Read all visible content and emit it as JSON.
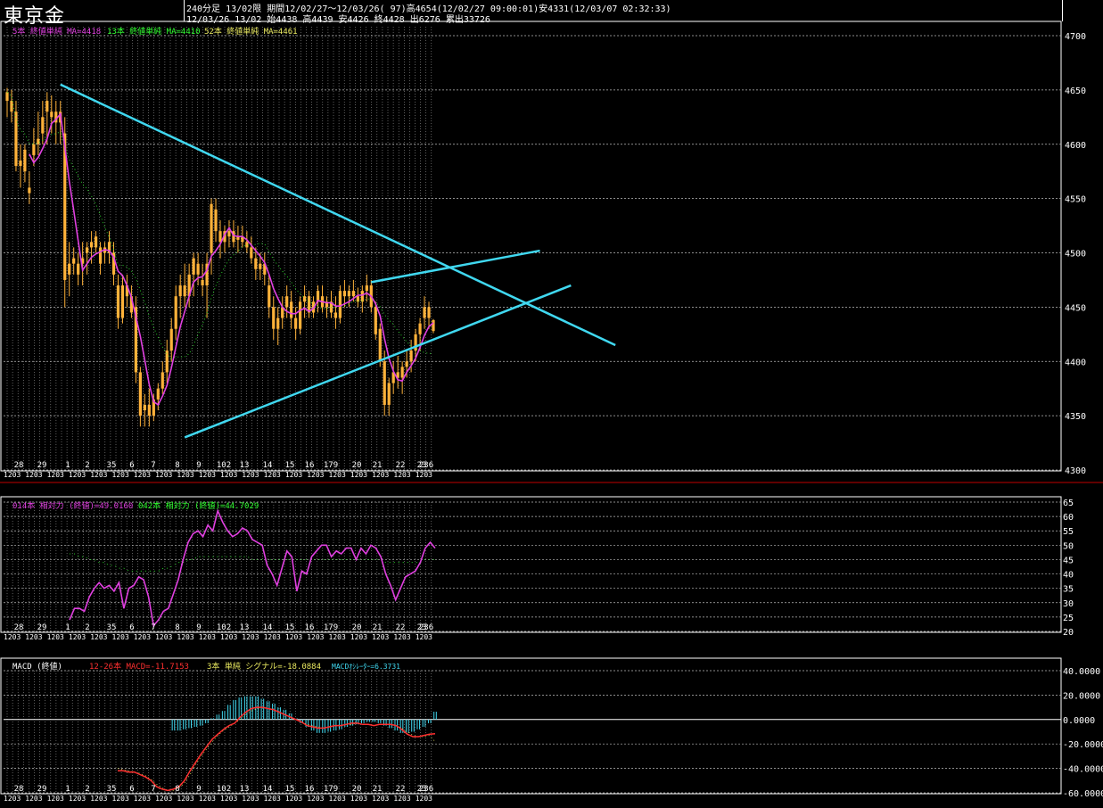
{
  "header": {
    "title": "東京金",
    "line1": "240分足 13/02限 期間12/02/27〜12/03/26( 97)高4654(12/02/27 09:00:01)安4331(12/03/07 02:32:33)",
    "line2": "12/03/26 13/02 始4438 高4439 安4426 終4428 出6276 累出33726"
  },
  "colors": {
    "up": "#ffb23a",
    "down": "#ffb23a",
    "ma5": "#e040e0",
    "ma13": "#30ff30",
    "ma52": "#e8e860",
    "trend": "#40d8f0",
    "grid": "#ffffff",
    "rsi14": "#e040e0",
    "rsi42": "#30ff30",
    "macd": "#ff3030",
    "signal": "#e8e860",
    "osc": "#40d8f0"
  },
  "x_labels": [
    "28",
    "29",
    "1",
    "2",
    "35",
    "6",
    "7",
    "8",
    "9",
    "102",
    "13",
    "14",
    "15",
    "16",
    "179",
    "20",
    "21",
    "22",
    "23",
    "236"
  ],
  "x_sub_label": "1203",
  "price_panel": {
    "legend_ma5": "5本 終値単純 MA=4418",
    "legend_ma13": "13本 終値単純 MA=4410",
    "legend_ma52": "52本 終値単純 MA=4461",
    "y_ticks": [
      "4700",
      "4650",
      "4600",
      "4550",
      "4500",
      "4450",
      "4400",
      "4350",
      "4300"
    ]
  },
  "rsi_panel": {
    "legend_rsi14": "014本 相対力 (終値)=49.0160",
    "legend_rsi42": "042本 相対力 (終値)=44.7029",
    "y_ticks": [
      "65",
      "60",
      "55",
      "50",
      "45",
      "40",
      "35",
      "30",
      "25",
      "20"
    ]
  },
  "macd_panel": {
    "legend_name": "MACD (終値)",
    "legend_macd": "12-26本 MACD=-11.7153",
    "legend_signal": "3本 単純 シグナル=-18.0884",
    "legend_osc": "MACDｵｼﾚｰﾀｰ=6.3731",
    "y_ticks": [
      "40.0000",
      "20.0000",
      "0.0000",
      "-20.0000",
      "-40.0000",
      "-60.0000"
    ]
  },
  "chart_data": [
    {
      "type": "candlestick",
      "ylim": [
        4300,
        4700
      ],
      "ohlc": [
        [
          4640,
          4652,
          4625,
          4648
        ],
        [
          4630,
          4650,
          4620,
          4640
        ],
        [
          4630,
          4640,
          4575,
          4580
        ],
        [
          4580,
          4600,
          4560,
          4585
        ],
        [
          4575,
          4600,
          4565,
          4595
        ],
        [
          4560,
          4575,
          4545,
          4555
        ],
        [
          4590,
          4615,
          4580,
          4600
        ],
        [
          4600,
          4630,
          4590,
          4605
        ],
        [
          4610,
          4640,
          4600,
          4625
        ],
        [
          4630,
          4648,
          4600,
          4640
        ],
        [
          4630,
          4645,
          4610,
          4625
        ],
        [
          4630,
          4640,
          4600,
          4620
        ],
        [
          4620,
          4640,
          4600,
          4630
        ],
        [
          4610,
          4625,
          4450,
          4475
        ],
        [
          4490,
          4510,
          4460,
          4480
        ],
        [
          4495,
          4505,
          4480,
          4490
        ],
        [
          4490,
          4500,
          4470,
          4480
        ],
        [
          4490,
          4510,
          4470,
          4495
        ],
        [
          4500,
          4510,
          4480,
          4505
        ],
        [
          4505,
          4520,
          4490,
          4510
        ],
        [
          4515,
          4520,
          4500,
          4505
        ],
        [
          4505,
          4510,
          4480,
          4490
        ],
        [
          4500,
          4510,
          4490,
          4505
        ],
        [
          4510,
          4520,
          4490,
          4500
        ],
        [
          4500,
          4510,
          4470,
          4480
        ],
        [
          4470,
          4480,
          4430,
          4440
        ],
        [
          4440,
          4480,
          4435,
          4470
        ],
        [
          4470,
          4480,
          4450,
          4460
        ],
        [
          4460,
          4470,
          4440,
          4445
        ],
        [
          4450,
          4460,
          4380,
          4390
        ],
        [
          4390,
          4395,
          4340,
          4350
        ],
        [
          4355,
          4370,
          4340,
          4360
        ],
        [
          4360,
          4375,
          4340,
          4350
        ],
        [
          4350,
          4370,
          4345,
          4365
        ],
        [
          4365,
          4380,
          4355,
          4375
        ],
        [
          4375,
          4400,
          4370,
          4390
        ],
        [
          4390,
          4420,
          4380,
          4410
        ],
        [
          4410,
          4440,
          4400,
          4430
        ],
        [
          4430,
          4470,
          4420,
          4460
        ],
        [
          4460,
          4480,
          4440,
          4470
        ],
        [
          4470,
          4490,
          4450,
          4460
        ],
        [
          4460,
          4490,
          4450,
          4480
        ],
        [
          4480,
          4500,
          4460,
          4495
        ],
        [
          4490,
          4500,
          4470,
          4480
        ],
        [
          4470,
          4490,
          4460,
          4475
        ],
        [
          4470,
          4500,
          4440,
          4490
        ],
        [
          4500,
          4550,
          4480,
          4545
        ],
        [
          4540,
          4550,
          4510,
          4520
        ],
        [
          4520,
          4530,
          4495,
          4510
        ],
        [
          4510,
          4525,
          4500,
          4520
        ],
        [
          4515,
          4530,
          4505,
          4520
        ],
        [
          4520,
          4530,
          4505,
          4510
        ],
        [
          4512,
          4525,
          4500,
          4515
        ],
        [
          4515,
          4525,
          4505,
          4510
        ],
        [
          4510,
          4520,
          4500,
          4505
        ],
        [
          4505,
          4515,
          4490,
          4495
        ],
        [
          4495,
          4505,
          4475,
          4485
        ],
        [
          4485,
          4500,
          4475,
          4490
        ],
        [
          4490,
          4500,
          4470,
          4480
        ],
        [
          4470,
          4480,
          4440,
          4450
        ],
        [
          4450,
          4460,
          4420,
          4430
        ],
        [
          4430,
          4450,
          4415,
          4440
        ],
        [
          4440,
          4460,
          4430,
          4450
        ],
        [
          4450,
          4470,
          4440,
          4460
        ],
        [
          4455,
          4465,
          4430,
          4440
        ],
        [
          4440,
          4450,
          4420,
          4430
        ],
        [
          4430,
          4460,
          4425,
          4455
        ],
        [
          4455,
          4470,
          4440,
          4460
        ],
        [
          4460,
          4465,
          4440,
          4445
        ],
        [
          4445,
          4460,
          4440,
          4455
        ],
        [
          4455,
          4470,
          4445,
          4465
        ],
        [
          4460,
          4470,
          4445,
          4450
        ],
        [
          4450,
          4460,
          4440,
          4455
        ],
        [
          4455,
          4465,
          4440,
          4445
        ],
        [
          4445,
          4460,
          4430,
          4440
        ],
        [
          4440,
          4470,
          4435,
          4465
        ],
        [
          4465,
          4475,
          4450,
          4460
        ],
        [
          4460,
          4470,
          4450,
          4465
        ],
        [
          4465,
          4475,
          4455,
          4460
        ],
        [
          4460,
          4468,
          4450,
          4455
        ],
        [
          4455,
          4470,
          4445,
          4465
        ],
        [
          4465,
          4480,
          4455,
          4470
        ],
        [
          4470,
          4475,
          4445,
          4450
        ],
        [
          4450,
          4455,
          4420,
          4425
        ],
        [
          4430,
          4435,
          4395,
          4400
        ],
        [
          4400,
          4410,
          4350,
          4360
        ],
        [
          4360,
          4385,
          4350,
          4380
        ],
        [
          4380,
          4400,
          4370,
          4390
        ],
        [
          4390,
          4405,
          4375,
          4385
        ],
        [
          4385,
          4400,
          4370,
          4395
        ],
        [
          4395,
          4410,
          4385,
          4400
        ],
        [
          4400,
          4420,
          4390,
          4410
        ],
        [
          4410,
          4430,
          4400,
          4425
        ],
        [
          4425,
          4440,
          4410,
          4435
        ],
        [
          4440,
          4460,
          4430,
          4450
        ],
        [
          4450,
          4455,
          4430,
          4440
        ],
        [
          4438,
          4439,
          4426,
          4428
        ]
      ],
      "trendlines_start_end": [
        {
          "from_bar": 12,
          "from_price": 4655,
          "to_bar": 137,
          "to_price": 4415
        },
        {
          "from_bar": 40,
          "from_price": 4330,
          "to_bar": 127,
          "to_price": 4470
        },
        {
          "from_bar": 82,
          "from_price": 4473,
          "to_bar": 120,
          "to_price": 4502
        }
      ]
    },
    {
      "type": "line",
      "title": "RSI",
      "ylim": [
        20,
        65
      ],
      "series": [
        {
          "name": "014本 相対力 (終値)",
          "values": [
            24,
            28,
            28,
            27,
            32,
            35,
            37,
            35,
            36,
            34,
            37,
            28,
            35,
            36,
            39,
            38,
            32,
            22,
            24,
            27,
            28,
            33,
            38,
            45,
            51,
            54,
            55,
            53,
            57,
            55,
            62,
            58,
            55,
            53,
            54,
            56,
            55,
            52,
            51,
            50,
            43,
            40,
            36,
            42,
            48,
            46,
            34,
            41,
            40,
            46,
            48,
            50,
            50,
            46,
            48,
            47,
            49,
            49,
            45,
            49,
            47,
            50,
            49,
            46,
            40,
            36,
            31,
            35,
            39,
            40,
            41,
            44,
            49,
            51,
            49
          ]
        },
        {
          "name": "042本 相対力 (終値)",
          "values": [
            47,
            47,
            46,
            46,
            45,
            45,
            44,
            44,
            43,
            43,
            42,
            42,
            41,
            41,
            41,
            41,
            41,
            41,
            41,
            42,
            42,
            43,
            44,
            44,
            45,
            45,
            46,
            46,
            46,
            46,
            46,
            46,
            46,
            46,
            46,
            46,
            46,
            45,
            45,
            45,
            45,
            45,
            45,
            45,
            45,
            45,
            45,
            45,
            45,
            45,
            45,
            45,
            45,
            45,
            45,
            45,
            45,
            45,
            45,
            45,
            45,
            45,
            45,
            45,
            44,
            44,
            44,
            44,
            44,
            44,
            44,
            44,
            45,
            45,
            45
          ]
        }
      ]
    },
    {
      "type": "bar+line",
      "title": "MACD (終値)",
      "ylim": [
        -60,
        40
      ],
      "series": [
        {
          "name": "MACD",
          "values": [
            -42,
            -42,
            -43,
            -43,
            -45,
            -47,
            -50,
            -55,
            -57,
            -58,
            -57,
            -55,
            -50,
            -42,
            -35,
            -28,
            -22,
            -16,
            -12,
            -8,
            -5,
            -3,
            2,
            6,
            9,
            10,
            10,
            9,
            8,
            6,
            4,
            2,
            0,
            -2,
            -5,
            -6,
            -7,
            -7,
            -6,
            -5,
            -5,
            -4,
            -3,
            -3,
            -4,
            -4,
            -5,
            -4,
            -4,
            -4,
            -5,
            -8,
            -12,
            -14,
            -14,
            -13,
            -12,
            -11.7
          ]
        },
        {
          "name": "シグナル",
          "values": [
            -40,
            -41,
            -42,
            -43,
            -44,
            -46,
            -49,
            -53,
            -56,
            -58,
            -58,
            -56,
            -52,
            -45,
            -37,
            -30,
            -24,
            -18,
            -13,
            -9,
            -6,
            -3,
            0,
            4,
            7,
            9,
            10,
            9,
            8,
            6,
            4,
            2,
            0,
            -2,
            -4,
            -5,
            -6,
            -7,
            -6,
            -5,
            -5,
            -4,
            -4,
            -3,
            -4,
            -4,
            -5,
            -4,
            -4,
            -4,
            -5,
            -7,
            -10,
            -13,
            -14,
            -14,
            -13,
            -18.1
          ]
        },
        {
          "name": "MACDｵｼﾚｰﾀｰ",
          "values": [
            0,
            0,
            0,
            0,
            0,
            0,
            0,
            0,
            0,
            0,
            -9,
            -9,
            -8,
            -7,
            -6,
            -5,
            -3,
            1,
            4,
            7,
            12,
            16,
            18,
            19,
            19,
            19,
            17,
            15,
            13,
            10,
            8,
            5,
            1,
            -3,
            -6,
            -9,
            -11,
            -11,
            -10,
            -9,
            -8,
            -6,
            -5,
            -4,
            -3,
            -2,
            -2,
            -3,
            -5,
            -7,
            -9,
            -11,
            -11,
            -10,
            -8,
            -6,
            -3,
            6.4
          ]
        }
      ]
    }
  ]
}
